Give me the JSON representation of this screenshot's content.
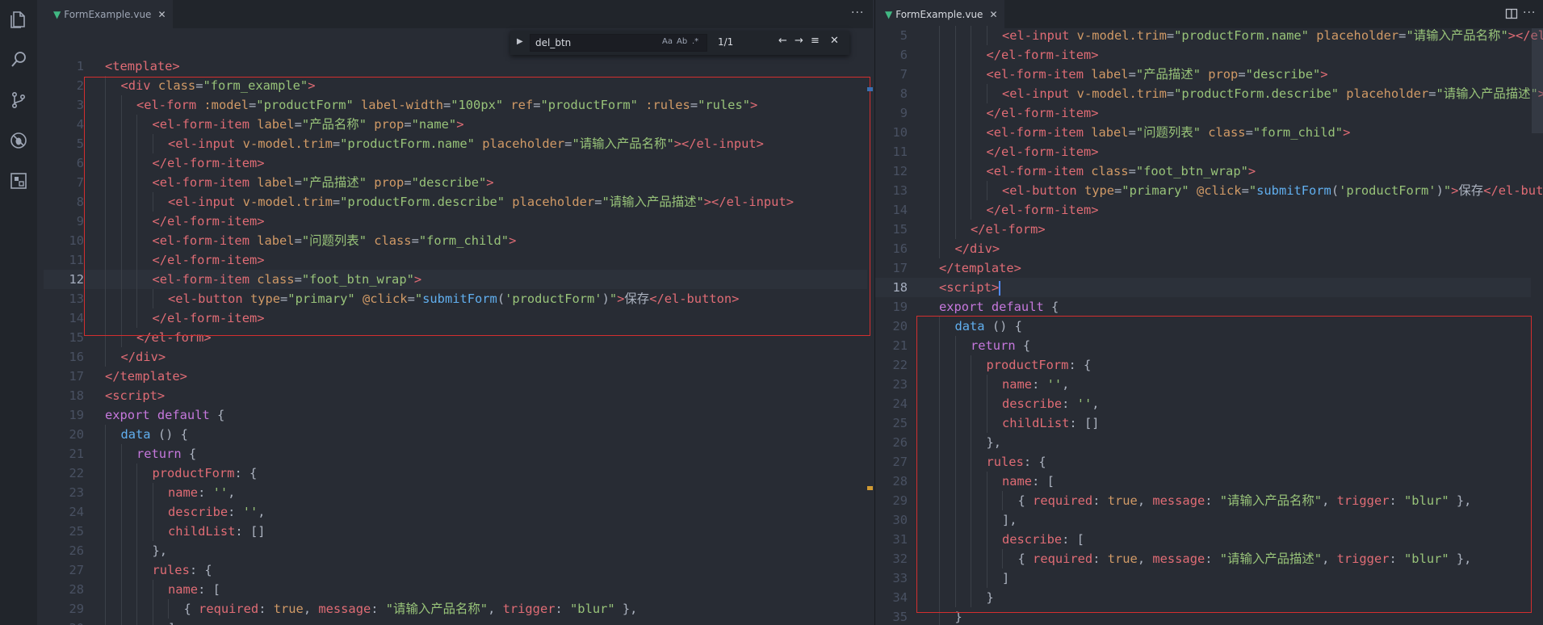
{
  "left_editor": {
    "tab_title": "FormExample.vue",
    "tab_icon": "vue-file-icon",
    "more_label": "···",
    "first_line": 1,
    "active_line": 12,
    "lines": [
      [
        [
          "tag",
          "<template>"
        ]
      ],
      [
        [
          "tag",
          "<div "
        ],
        [
          "attr",
          "class"
        ],
        [
          "punc",
          "="
        ],
        [
          "str",
          "\"form_example\""
        ],
        [
          "tag",
          ">"
        ]
      ],
      [
        [
          "tag",
          "<el-form "
        ],
        [
          "attr",
          ":model"
        ],
        [
          "punc",
          "="
        ],
        [
          "str",
          "\"productForm\""
        ],
        [
          "attr",
          " label-width"
        ],
        [
          "punc",
          "="
        ],
        [
          "str",
          "\"100px\""
        ],
        [
          "attr",
          " ref"
        ],
        [
          "punc",
          "="
        ],
        [
          "str",
          "\"productForm\""
        ],
        [
          "attr",
          " :rules"
        ],
        [
          "punc",
          "="
        ],
        [
          "str",
          "\"rules\""
        ],
        [
          "tag",
          ">"
        ]
      ],
      [
        [
          "tag",
          "<el-form-item "
        ],
        [
          "attr",
          "label"
        ],
        [
          "punc",
          "="
        ],
        [
          "str",
          "\"产品名称\""
        ],
        [
          "attr",
          " prop"
        ],
        [
          "punc",
          "="
        ],
        [
          "str",
          "\"name\""
        ],
        [
          "tag",
          ">"
        ]
      ],
      [
        [
          "tag",
          "<el-input "
        ],
        [
          "attr",
          "v-model.trim"
        ],
        [
          "punc",
          "="
        ],
        [
          "str",
          "\"productForm.name\""
        ],
        [
          "attr",
          " placeholder"
        ],
        [
          "punc",
          "="
        ],
        [
          "str",
          "\"请输入产品名称\""
        ],
        [
          "tag",
          "></el-input>"
        ]
      ],
      [
        [
          "tag",
          "</el-form-item>"
        ]
      ],
      [
        [
          "tag",
          "<el-form-item "
        ],
        [
          "attr",
          "label"
        ],
        [
          "punc",
          "="
        ],
        [
          "str",
          "\"产品描述\""
        ],
        [
          "attr",
          " prop"
        ],
        [
          "punc",
          "="
        ],
        [
          "str",
          "\"describe\""
        ],
        [
          "tag",
          ">"
        ]
      ],
      [
        [
          "tag",
          "<el-input "
        ],
        [
          "attr",
          "v-model.trim"
        ],
        [
          "punc",
          "="
        ],
        [
          "str",
          "\"productForm.describe\""
        ],
        [
          "attr",
          " placeholder"
        ],
        [
          "punc",
          "="
        ],
        [
          "str",
          "\"请输入产品描述\""
        ],
        [
          "tag",
          "></el-input>"
        ]
      ],
      [
        [
          "tag",
          "</el-form-item>"
        ]
      ],
      [
        [
          "tag",
          "<el-form-item "
        ],
        [
          "attr",
          "label"
        ],
        [
          "punc",
          "="
        ],
        [
          "str",
          "\"问题列表\""
        ],
        [
          "attr",
          " class"
        ],
        [
          "punc",
          "="
        ],
        [
          "str",
          "\"form_child\""
        ],
        [
          "tag",
          ">"
        ]
      ],
      [
        [
          "tag",
          "</el-form-item>"
        ]
      ],
      [
        [
          "tag",
          "<el-form-item "
        ],
        [
          "attr",
          "class"
        ],
        [
          "punc",
          "="
        ],
        [
          "str",
          "\"foot_btn_wrap\""
        ],
        [
          "tag",
          ">"
        ]
      ],
      [
        [
          "tag",
          "<el-button "
        ],
        [
          "attr",
          "type"
        ],
        [
          "punc",
          "="
        ],
        [
          "str",
          "\"primary\""
        ],
        [
          "attr",
          " @click"
        ],
        [
          "punc",
          "="
        ],
        [
          "str",
          "\""
        ],
        [
          "fn",
          "submitForm"
        ],
        [
          "punc",
          "("
        ],
        [
          "str",
          "'productForm'"
        ],
        [
          "punc",
          ")"
        ],
        [
          "str",
          "\""
        ],
        [
          "tag",
          ">"
        ],
        [
          "plain",
          "保存"
        ],
        [
          "tag",
          "</el-button>"
        ]
      ],
      [
        [
          "tag",
          "</el-form-item>"
        ]
      ],
      [
        [
          "tag",
          "</el-form>"
        ]
      ],
      [
        [
          "tag",
          "</div>"
        ]
      ],
      [
        [
          "tag",
          "</template>"
        ]
      ],
      [
        [
          "tag",
          "<script>"
        ]
      ],
      [
        [
          "key",
          "export default"
        ],
        [
          "punc",
          " {"
        ]
      ],
      [
        [
          "fn",
          "data"
        ],
        [
          "punc",
          " () {"
        ]
      ],
      [
        [
          "key",
          "return"
        ],
        [
          "punc",
          " {"
        ]
      ],
      [
        [
          "prop",
          "productForm"
        ],
        [
          "punc",
          ": {"
        ]
      ],
      [
        [
          "prop",
          "name"
        ],
        [
          "punc",
          ": "
        ],
        [
          "str",
          "''"
        ],
        [
          "punc",
          ","
        ]
      ],
      [
        [
          "prop",
          "describe"
        ],
        [
          "punc",
          ": "
        ],
        [
          "str",
          "''"
        ],
        [
          "punc",
          ","
        ]
      ],
      [
        [
          "prop",
          "childList"
        ],
        [
          "punc",
          ": []"
        ]
      ],
      [
        [
          "punc",
          "},"
        ]
      ],
      [
        [
          "prop",
          "rules"
        ],
        [
          "punc",
          ": {"
        ]
      ],
      [
        [
          "prop",
          "name"
        ],
        [
          "punc",
          ": ["
        ]
      ],
      [
        [
          "punc",
          "{ "
        ],
        [
          "prop",
          "required"
        ],
        [
          "punc",
          ": "
        ],
        [
          "bool",
          "true"
        ],
        [
          "punc",
          ", "
        ],
        [
          "prop",
          "message"
        ],
        [
          "punc",
          ": "
        ],
        [
          "str",
          "\"请输入产品名称\""
        ],
        [
          "punc",
          ", "
        ],
        [
          "prop",
          "trigger"
        ],
        [
          "punc",
          ": "
        ],
        [
          "str",
          "\"blur\""
        ],
        [
          "punc",
          " },"
        ]
      ],
      [
        [
          "punc",
          "],"
        ]
      ]
    ]
  },
  "right_editor": {
    "tab_title": "FormExample.vue",
    "tab_icon": "vue-file-icon",
    "more_label": "···",
    "first_line": 5,
    "active_line": 18,
    "lines": [
      [
        [
          "tag",
          "<el-input "
        ],
        [
          "attr",
          "v-model.trim"
        ],
        [
          "punc",
          "="
        ],
        [
          "str",
          "\"productForm.name\""
        ],
        [
          "attr",
          " placeholder"
        ],
        [
          "punc",
          "="
        ],
        [
          "str",
          "\"请输入产品名称\""
        ],
        [
          "tag",
          "></el-input>"
        ]
      ],
      [
        [
          "tag",
          "</el-form-item>"
        ]
      ],
      [
        [
          "tag",
          "<el-form-item "
        ],
        [
          "attr",
          "label"
        ],
        [
          "punc",
          "="
        ],
        [
          "str",
          "\"产品描述\""
        ],
        [
          "attr",
          " prop"
        ],
        [
          "punc",
          "="
        ],
        [
          "str",
          "\"describe\""
        ],
        [
          "tag",
          ">"
        ]
      ],
      [
        [
          "tag",
          "<el-input "
        ],
        [
          "attr",
          "v-model.trim"
        ],
        [
          "punc",
          "="
        ],
        [
          "str",
          "\"productForm.describe\""
        ],
        [
          "attr",
          " placeholder"
        ],
        [
          "punc",
          "="
        ],
        [
          "str",
          "\"请输入产品描述\""
        ],
        [
          "tag",
          "></el-input>"
        ]
      ],
      [
        [
          "tag",
          "</el-form-item>"
        ]
      ],
      [
        [
          "tag",
          "<el-form-item "
        ],
        [
          "attr",
          "label"
        ],
        [
          "punc",
          "="
        ],
        [
          "str",
          "\"问题列表\""
        ],
        [
          "attr",
          " class"
        ],
        [
          "punc",
          "="
        ],
        [
          "str",
          "\"form_child\""
        ],
        [
          "tag",
          ">"
        ]
      ],
      [
        [
          "tag",
          "</el-form-item>"
        ]
      ],
      [
        [
          "tag",
          "<el-form-item "
        ],
        [
          "attr",
          "class"
        ],
        [
          "punc",
          "="
        ],
        [
          "str",
          "\"foot_btn_wrap\""
        ],
        [
          "tag",
          ">"
        ]
      ],
      [
        [
          "tag",
          "<el-button "
        ],
        [
          "attr",
          "type"
        ],
        [
          "punc",
          "="
        ],
        [
          "str",
          "\"primary\""
        ],
        [
          "attr",
          " @click"
        ],
        [
          "punc",
          "="
        ],
        [
          "str",
          "\""
        ],
        [
          "fn",
          "submitForm"
        ],
        [
          "punc",
          "("
        ],
        [
          "str",
          "'productForm'"
        ],
        [
          "punc",
          ")"
        ],
        [
          "str",
          "\""
        ],
        [
          "tag",
          ">"
        ],
        [
          "plain",
          "保存"
        ],
        [
          "tag",
          "</el-button>"
        ]
      ],
      [
        [
          "tag",
          "</el-form-item>"
        ]
      ],
      [
        [
          "tag",
          "</el-form>"
        ]
      ],
      [
        [
          "tag",
          "</div>"
        ]
      ],
      [
        [
          "tag",
          "</template>"
        ]
      ],
      [
        [
          "tag",
          "<script>"
        ]
      ],
      [
        [
          "key",
          "export default"
        ],
        [
          "punc",
          " {"
        ]
      ],
      [
        [
          "fn",
          "data"
        ],
        [
          "punc",
          " () {"
        ]
      ],
      [
        [
          "key",
          "return"
        ],
        [
          "punc",
          " {"
        ]
      ],
      [
        [
          "prop",
          "productForm"
        ],
        [
          "punc",
          ": {"
        ]
      ],
      [
        [
          "prop",
          "name"
        ],
        [
          "punc",
          ": "
        ],
        [
          "str",
          "''"
        ],
        [
          "punc",
          ","
        ]
      ],
      [
        [
          "prop",
          "describe"
        ],
        [
          "punc",
          ": "
        ],
        [
          "str",
          "''"
        ],
        [
          "punc",
          ","
        ]
      ],
      [
        [
          "prop",
          "childList"
        ],
        [
          "punc",
          ": []"
        ]
      ],
      [
        [
          "punc",
          "},"
        ]
      ],
      [
        [
          "prop",
          "rules"
        ],
        [
          "punc",
          ": {"
        ]
      ],
      [
        [
          "prop",
          "name"
        ],
        [
          "punc",
          ": ["
        ]
      ],
      [
        [
          "punc",
          "{ "
        ],
        [
          "prop",
          "required"
        ],
        [
          "punc",
          ": "
        ],
        [
          "bool",
          "true"
        ],
        [
          "punc",
          ", "
        ],
        [
          "prop",
          "message"
        ],
        [
          "punc",
          ": "
        ],
        [
          "str",
          "\"请输入产品名称\""
        ],
        [
          "punc",
          ", "
        ],
        [
          "prop",
          "trigger"
        ],
        [
          "punc",
          ": "
        ],
        [
          "str",
          "\"blur\""
        ],
        [
          "punc",
          " },"
        ]
      ],
      [
        [
          "punc",
          "],"
        ]
      ],
      [
        [
          "prop",
          "describe"
        ],
        [
          "punc",
          ": ["
        ]
      ],
      [
        [
          "punc",
          "{ "
        ],
        [
          "prop",
          "required"
        ],
        [
          "punc",
          ": "
        ],
        [
          "bool",
          "true"
        ],
        [
          "punc",
          ", "
        ],
        [
          "prop",
          "message"
        ],
        [
          "punc",
          ": "
        ],
        [
          "str",
          "\"请输入产品描述\""
        ],
        [
          "punc",
          ", "
        ],
        [
          "prop",
          "trigger"
        ],
        [
          "punc",
          ": "
        ],
        [
          "str",
          "\"blur\""
        ],
        [
          "punc",
          " },"
        ]
      ],
      [
        [
          "punc",
          "]"
        ]
      ],
      [
        [
          "punc",
          "}"
        ]
      ],
      [
        [
          "punc",
          "}"
        ]
      ]
    ]
  },
  "find_widget": {
    "query": "del_btn",
    "match_case": "Aa",
    "whole_word": "Ab",
    "regex": ".*",
    "count": "1/1",
    "prev_icon": "←",
    "next_icon": "→",
    "selection_icon": "≡",
    "close_icon": "✕"
  },
  "colors": {
    "background": "#282c34",
    "highlight_box": "#d32f2f",
    "tag": "#e06c75",
    "attr": "#d19a66",
    "string": "#98c379",
    "keyword": "#c678dd",
    "function": "#61afef"
  },
  "activity_bar": [
    "explorer-icon",
    "search-icon",
    "source-control-icon",
    "debug-icon",
    "extensions-icon"
  ]
}
